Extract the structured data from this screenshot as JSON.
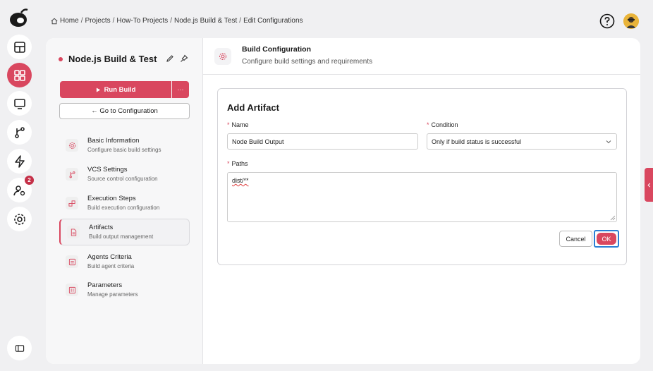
{
  "nav": {
    "items": [
      {
        "name": "dashboard-icon"
      },
      {
        "name": "projects-icon",
        "active": true
      },
      {
        "name": "monitor-icon"
      },
      {
        "name": "vcs-icon"
      },
      {
        "name": "lightning-icon"
      },
      {
        "name": "agents-icon",
        "badge": "2"
      },
      {
        "name": "settings-gear-icon"
      }
    ]
  },
  "breadcrumb": {
    "items": [
      "Home",
      "Projects",
      "How-To Projects",
      "Node.js Build & Test"
    ],
    "current": "Edit Configurations",
    "separator": "/"
  },
  "project": {
    "title": "Node.js Build & Test",
    "run_label": "Run Build",
    "more_label": "···",
    "goto_label": "← Go to Configuration"
  },
  "menu": [
    {
      "label": "Basic Information",
      "sub": "Configure basic build settings",
      "icon": "gear-icon"
    },
    {
      "label": "VCS Settings",
      "sub": "Source control configuration",
      "icon": "branch-icon"
    },
    {
      "label": "Execution Steps",
      "sub": "Build execution configuration",
      "icon": "steps-icon"
    },
    {
      "label": "Artifacts",
      "sub": "Build output management",
      "icon": "file-icon",
      "active": true
    },
    {
      "label": "Agents Criteria",
      "sub": "Build agent criteria",
      "icon": "agent-icon"
    },
    {
      "label": "Parameters",
      "sub": "Manage parameters",
      "icon": "parameters-icon"
    }
  ],
  "header": {
    "title": "Build Configuration",
    "subtitle": "Configure build settings and requirements"
  },
  "artifact_form": {
    "title": "Add Artifact",
    "name_label": "Name",
    "name_value": "Node Build Output",
    "condition_label": "Condition",
    "condition_value": "Only if build status is successful",
    "paths_label": "Paths",
    "paths_value": "dist/**",
    "required_mark": "*",
    "cancel_label": "Cancel",
    "ok_label": "OK"
  },
  "colors": {
    "accent": "#d9475f",
    "focus": "#2a7fd4"
  }
}
